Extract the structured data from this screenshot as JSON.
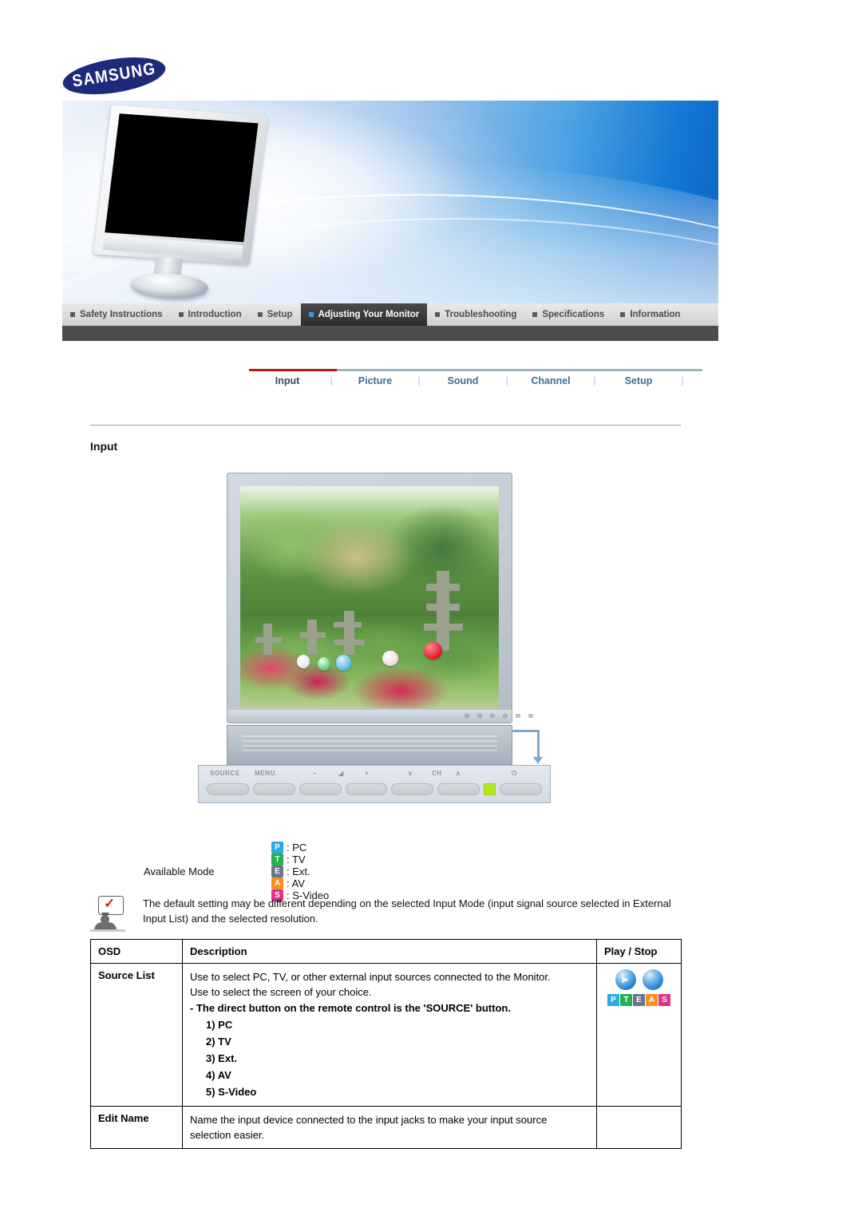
{
  "brand": {
    "logo_text": "SAMSUNG"
  },
  "main_nav": {
    "items": [
      {
        "label": "Safety Instructions",
        "active": false
      },
      {
        "label": "Introduction",
        "active": false
      },
      {
        "label": "Setup",
        "active": false
      },
      {
        "label": "Adjusting Your Monitor",
        "active": true
      },
      {
        "label": "Troubleshooting",
        "active": false
      },
      {
        "label": "Specifications",
        "active": false
      },
      {
        "label": "Information",
        "active": false
      }
    ]
  },
  "sub_nav": {
    "items": [
      {
        "label": "Input",
        "active": true
      },
      {
        "label": "Picture",
        "active": false
      },
      {
        "label": "Sound",
        "active": false
      },
      {
        "label": "Channel",
        "active": false
      },
      {
        "label": "Setup",
        "active": false
      }
    ],
    "separator": "|"
  },
  "page": {
    "title": "Input"
  },
  "control_panel": {
    "labels": [
      "SOURCE",
      "MENU",
      "–",
      "◢",
      "+",
      "∨",
      "CH",
      "∧",
      "⏻"
    ],
    "power_label": "⏻",
    "led_color": "#b4e81e"
  },
  "available_mode": {
    "label": "Available Mode",
    "modes": [
      {
        "badge": "P",
        "name": "PC",
        "text": ": PC",
        "color": "#29abe2"
      },
      {
        "badge": "T",
        "name": "TV",
        "text": ": TV",
        "color": "#22b14c"
      },
      {
        "badge": "E",
        "name": "Ext.",
        "text": ": Ext.",
        "color": "#68768c"
      },
      {
        "badge": "A",
        "name": "AV",
        "text": ": AV",
        "color": "#f7901e"
      },
      {
        "badge": "S",
        "name": "S-Video",
        "text": ": S-Video",
        "color": "#e5318d"
      }
    ]
  },
  "note": {
    "icon": "note-person-check-icon",
    "text": "The default setting may be different depending on the selected Input Mode (input signal source selected in External Input List) and the selected resolution."
  },
  "table": {
    "headers": {
      "osd": "OSD",
      "description": "Description",
      "play_stop": "Play / Stop"
    },
    "rows": [
      {
        "osd": "Source List",
        "lines": [
          {
            "style": "normal",
            "text": "Use to select PC, TV, or other external input sources connected to the Monitor."
          },
          {
            "style": "normal",
            "text": "Use to select the screen of your choice."
          },
          {
            "style": "bold",
            "text": "- The direct button on the remote control is the 'SOURCE' button."
          },
          {
            "style": "num",
            "text": "1) PC"
          },
          {
            "style": "num",
            "text": "2) TV"
          },
          {
            "style": "num",
            "text": "3) Ext."
          },
          {
            "style": "num",
            "text": "4) AV"
          },
          {
            "style": "num",
            "text": "5) S-Video"
          }
        ],
        "play": {
          "has_icons": true,
          "play_glyph": "▶",
          "stop_glyph": "",
          "badges": [
            {
              "badge": "P",
              "color": "#29abe2"
            },
            {
              "badge": "T",
              "color": "#22b14c"
            },
            {
              "badge": "E",
              "color": "#68768c"
            },
            {
              "badge": "A",
              "color": "#f7901e"
            },
            {
              "badge": "S",
              "color": "#e5318d"
            }
          ]
        }
      },
      {
        "osd": "Edit Name",
        "lines": [
          {
            "style": "normal",
            "text": "Name the input device connected to the input jacks to make your input source selection easier."
          }
        ],
        "play": {
          "has_icons": false,
          "badges": []
        }
      }
    ]
  },
  "colors": {
    "accent_red": "#b31b1b",
    "nav_active_bg": "#3a3a3a",
    "subnav_link": "#3d6e91",
    "banner_blue": "#1478d4"
  }
}
